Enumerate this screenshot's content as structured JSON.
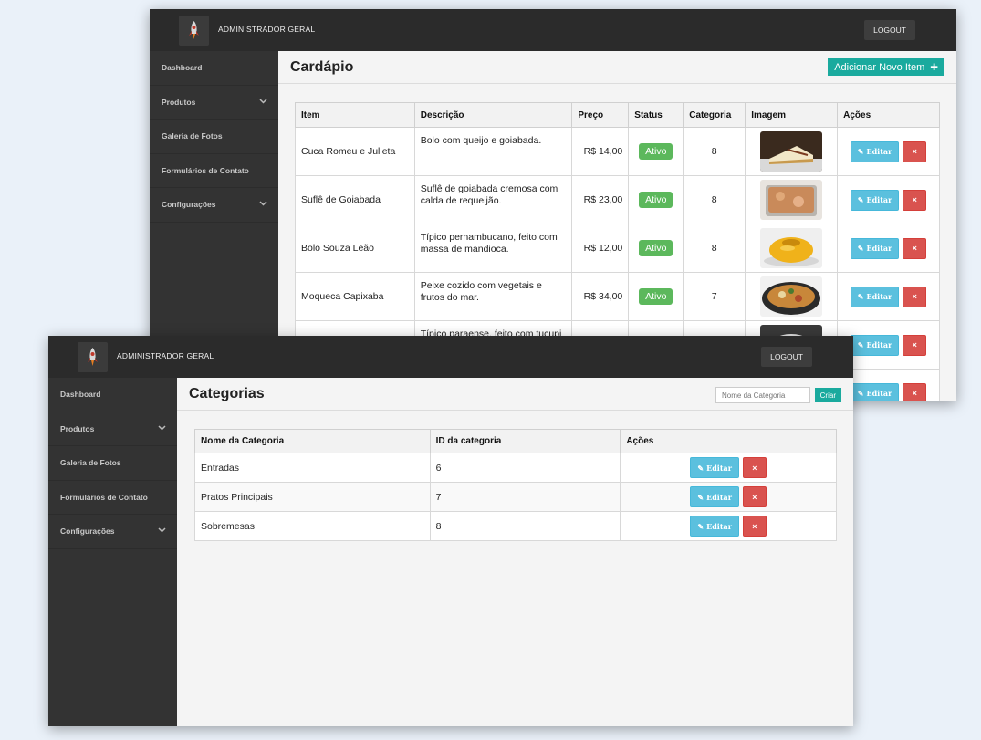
{
  "admin_title": "ADMINISTRADOR GERAL",
  "logout_label": "LOGOUT",
  "sidebar": {
    "items": [
      {
        "label": "Dashboard",
        "has_submenu": false
      },
      {
        "label": "Produtos",
        "has_submenu": true
      },
      {
        "label": "Galeria de Fotos",
        "has_submenu": false
      },
      {
        "label": "Formulários de Contato",
        "has_submenu": false
      },
      {
        "label": "Configurações",
        "has_submenu": true
      }
    ]
  },
  "menu_page": {
    "title": "Cardápio",
    "add_button_label": "Adicionar Novo Item",
    "columns": [
      "Item",
      "Descrição",
      "Preço",
      "Status",
      "Categoria",
      "Imagem",
      "Ações"
    ],
    "rows": [
      {
        "item": "Cuca Romeu e Julieta",
        "description": "Bolo com queijo e goiabada.",
        "price": "R$ 14,00",
        "status": "Ativo",
        "category": "8",
        "image": "food-photo-cheesecake"
      },
      {
        "item": "Suflê de Goiabada",
        "description": " Suflê de goiabada cremosa com calda de requeijão.",
        "price": "R$ 23,00",
        "status": "Ativo",
        "category": "8",
        "image": "food-photo-souffle"
      },
      {
        "item": "Bolo Souza Leão",
        "description": "Típico pernambucano, feito com massa de mandioca.",
        "price": "R$ 12,00",
        "status": "Ativo",
        "category": "8",
        "image": "food-photo-pudding"
      },
      {
        "item": "Moqueca Capixaba",
        "description": "Peixe cozido com vegetais e frutos do mar.",
        "price": "R$ 34,00",
        "status": "Ativo",
        "category": "7",
        "image": "food-photo-moqueca"
      },
      {
        "item": "",
        "description": "Típico paraense, feito com tucupi",
        "price": "",
        "status": "",
        "category": "",
        "image": "food-photo-bowl"
      }
    ],
    "edit_label": "Editar",
    "delete_label": "×"
  },
  "categories_page": {
    "title": "Categorias",
    "search_placeholder": "Nome da Categoria",
    "create_label": "Criar",
    "columns": [
      "Nome da Categoria",
      "ID da categoria",
      "Ações"
    ],
    "rows": [
      {
        "name": "Entradas",
        "id": "6"
      },
      {
        "name": "Pratos Principais",
        "id": "7"
      },
      {
        "name": "Sobremesas",
        "id": "8"
      }
    ],
    "edit_label": "Editar",
    "delete_label": "×"
  },
  "colors": {
    "topbar": "#2b2b2b",
    "sidebar": "#333333",
    "teal_accent": "#1aaa9e",
    "badge_active": "#5cb85c",
    "edit_button": "#5bc0de",
    "delete_button": "#d9534f",
    "page_background": "#eaf1f9"
  }
}
